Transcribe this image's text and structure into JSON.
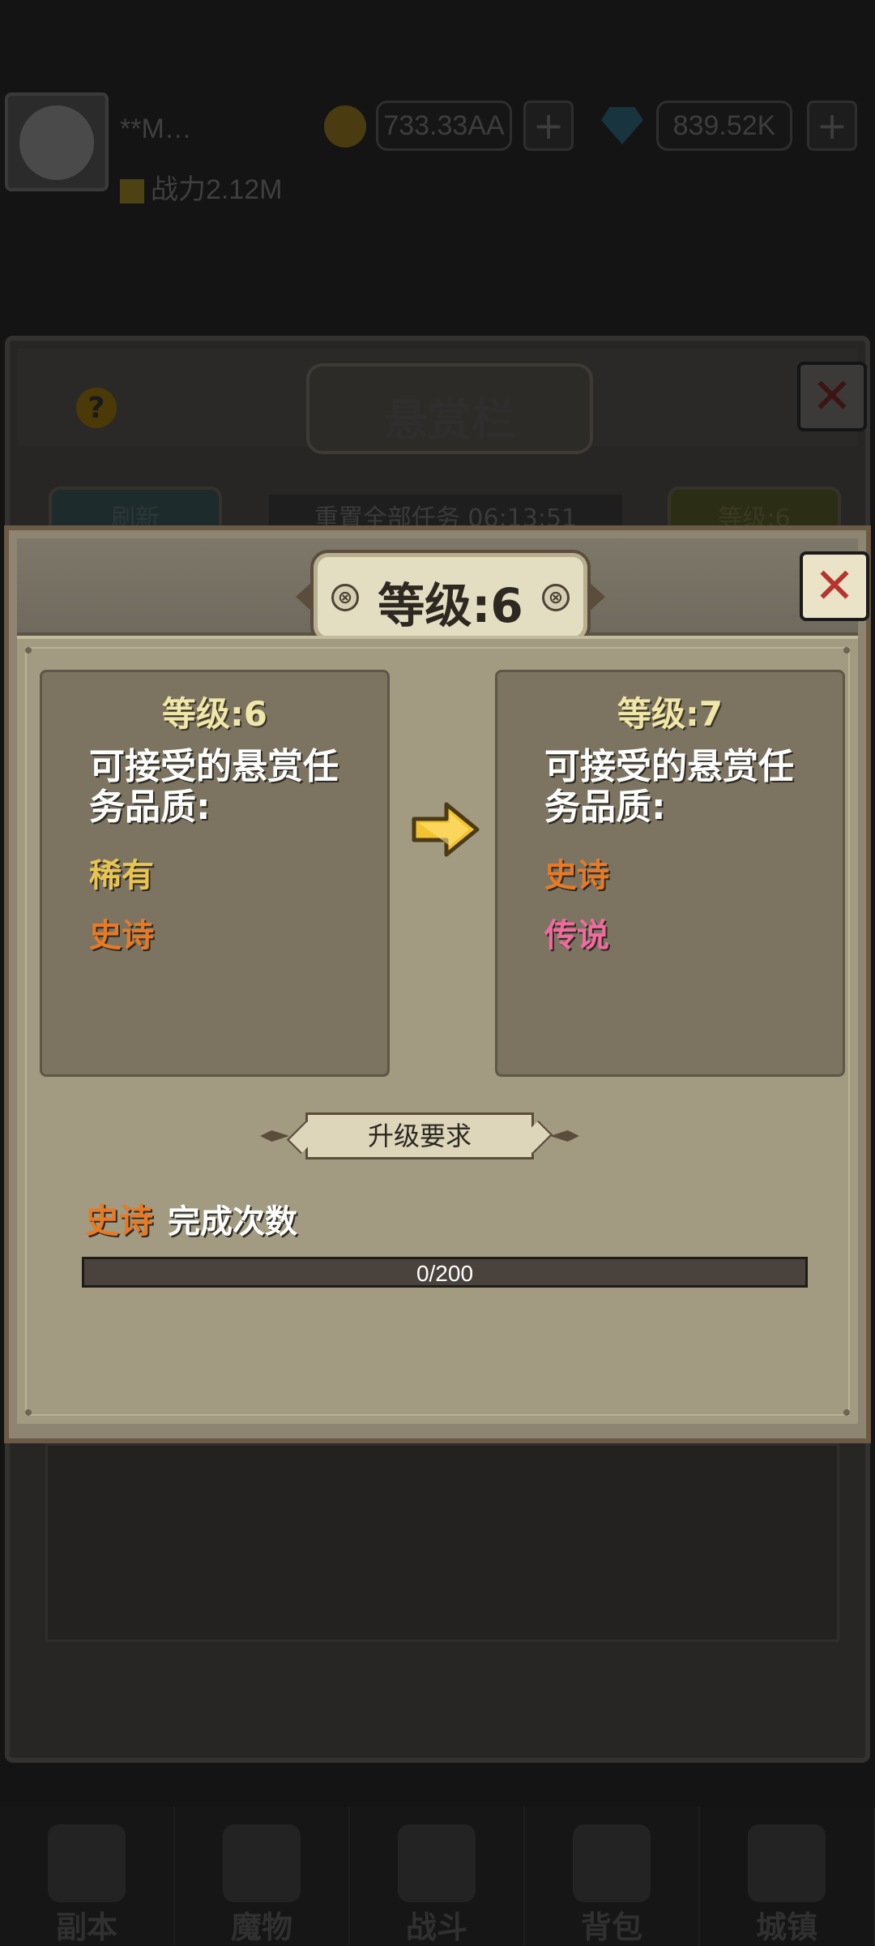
{
  "background": {
    "player_name": "**M…",
    "power": "战力2.12M",
    "gold": "733.33AA",
    "gems": "839.52K",
    "plus_glyph": "+",
    "bounty_panel": {
      "help_glyph": "?",
      "title": "悬赏栏",
      "close_glyph": "✕",
      "refresh_label": "刷新",
      "reset_text": "重置全部任务 06:13:51",
      "level_button": "等级:6"
    },
    "bottom_nav": [
      {
        "label": "副本"
      },
      {
        "label": "魔物"
      },
      {
        "label": "战斗"
      },
      {
        "label": "背包"
      },
      {
        "label": "城镇"
      }
    ]
  },
  "dialog": {
    "title": "等级:6",
    "knob_glyph": "⊗",
    "close_glyph": "✕",
    "current": {
      "level": "等级:6",
      "description": "可接受的悬赏任务品质:",
      "qualities": [
        "稀有",
        "史诗"
      ]
    },
    "next": {
      "level": "等级:7",
      "description": "可接受的悬赏任务品质:",
      "qualities": [
        "史诗",
        "传说"
      ]
    },
    "requirement_title": "升级要求",
    "requirement": {
      "quality": "史诗",
      "label": "完成次数",
      "progress_text": "0/200",
      "progress_value": 0,
      "progress_max": 200
    }
  },
  "colors": {
    "rare": "#e8c552",
    "epic": "#e87a26",
    "legend": "#f06aa0",
    "close_x": "#b7342e"
  }
}
